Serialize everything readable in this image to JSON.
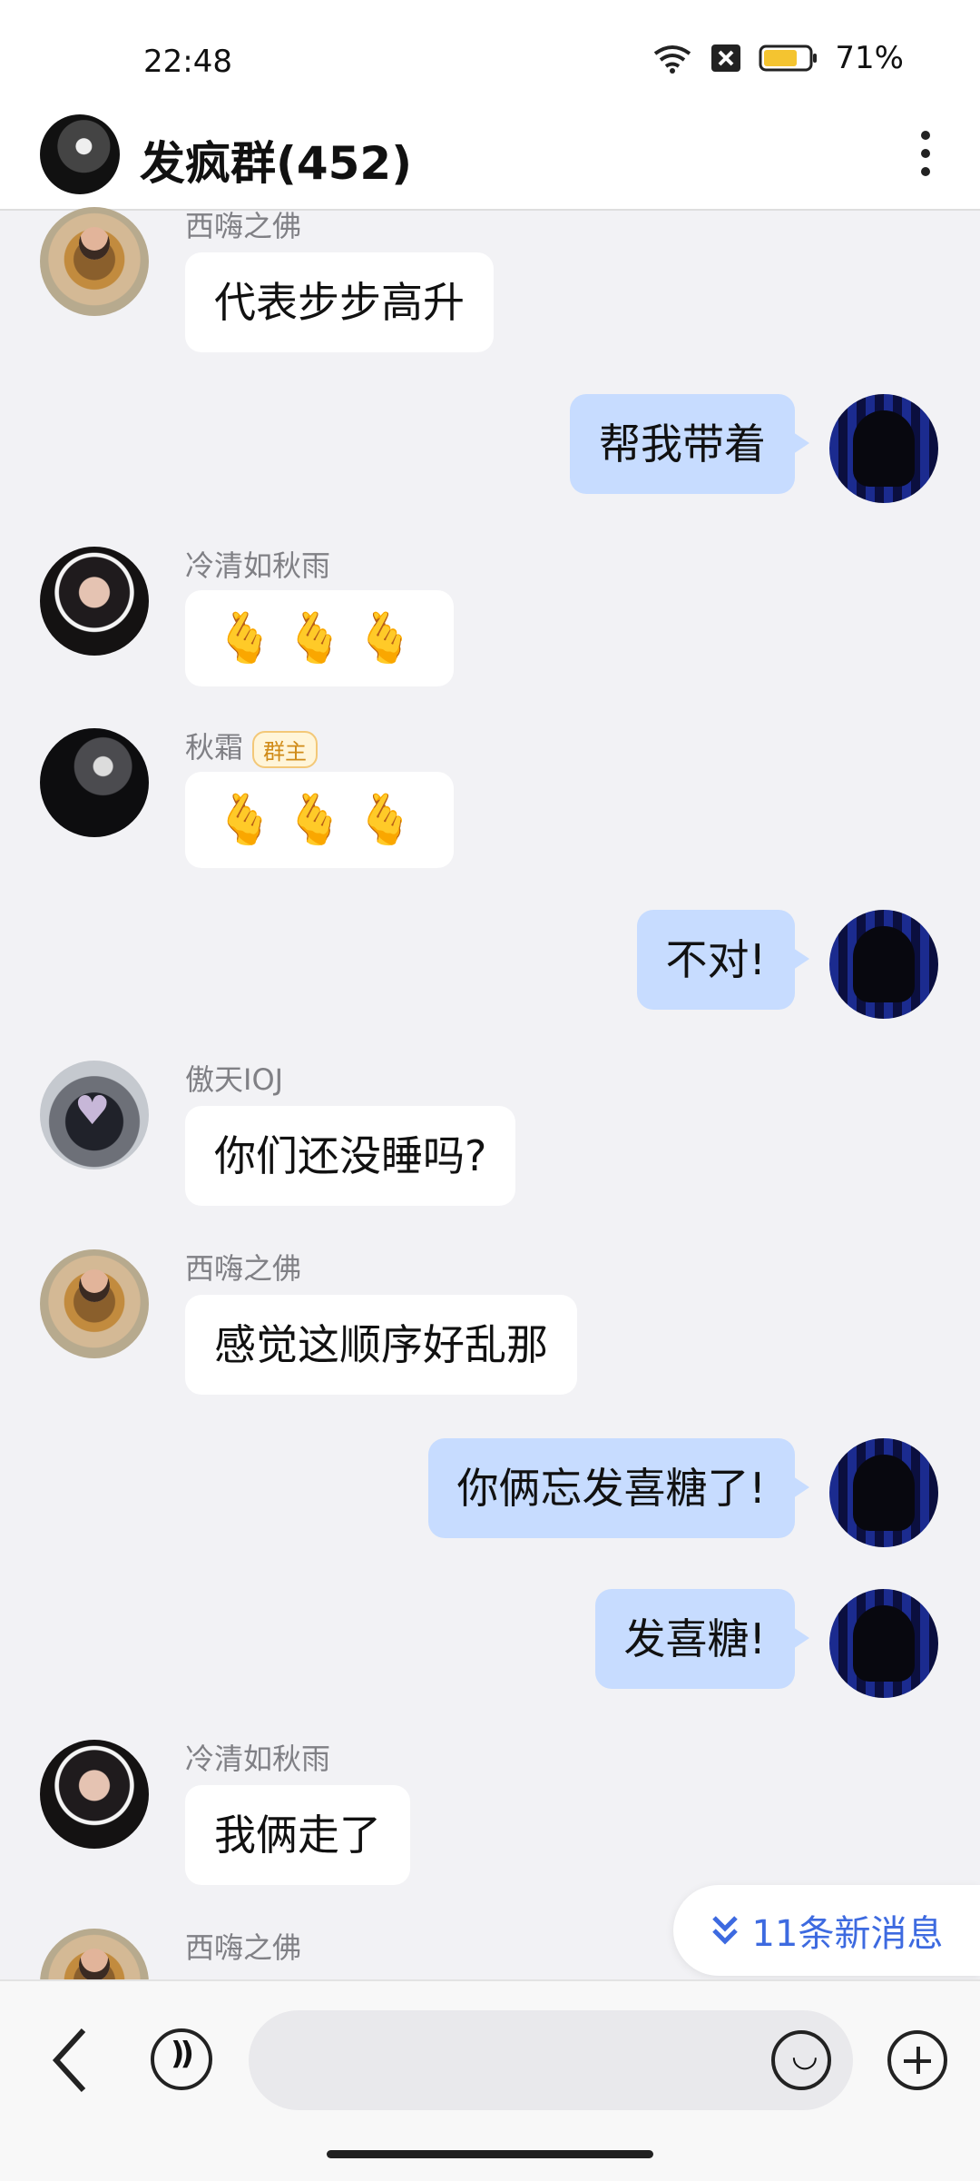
{
  "status_bar": {
    "time": "22:48",
    "battery": "71%"
  },
  "header": {
    "title": "发疯群(452)"
  },
  "messages": [
    {
      "sender": "西嗨之佛",
      "text": "代表步步高升"
    },
    {
      "text": "帮我带着"
    },
    {
      "sender": "冷清如秋雨",
      "text": "🫰🫰🫰"
    },
    {
      "sender": "秋霜",
      "badge": "群主",
      "text": "🫰🫰🫰"
    },
    {
      "text": "不对!"
    },
    {
      "sender": "傲天IOJ",
      "text": "你们还没睡吗?"
    },
    {
      "sender": "西嗨之佛",
      "text": "感觉这顺序好乱那"
    },
    {
      "text": "你俩忘发喜糖了!"
    },
    {
      "text": "发喜糖!"
    },
    {
      "sender": "冷清如秋雨",
      "text": "我俩走了"
    },
    {
      "sender": "西嗨之佛"
    }
  ],
  "new_messages": "11条新消息",
  "input": {
    "placeholder": ""
  },
  "colors": {
    "my_bubble": "#c7dcff",
    "accent": "#3d6ae0"
  },
  "icons": [
    "back-icon",
    "voice-icon",
    "emoji-icon",
    "plus-icon",
    "more-icon",
    "double-chevron-down-icon"
  ]
}
